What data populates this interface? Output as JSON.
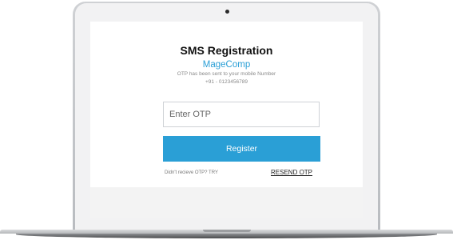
{
  "form": {
    "title": "SMS Registration",
    "brand": "MageComp",
    "otp_note": "OTP has been sent to your mobile Number",
    "phone": "+91 - 0123456789",
    "otp_placeholder": "Enter OTP",
    "register_label": "Register",
    "didnt_receive_text": "Didn't recieve OTP? TRY",
    "resend_label": "RESEND OTP"
  },
  "colors": {
    "accent": "#2a9fd6",
    "laptop_frame": "#c4c6c9",
    "screen_background": "#ffffff"
  }
}
